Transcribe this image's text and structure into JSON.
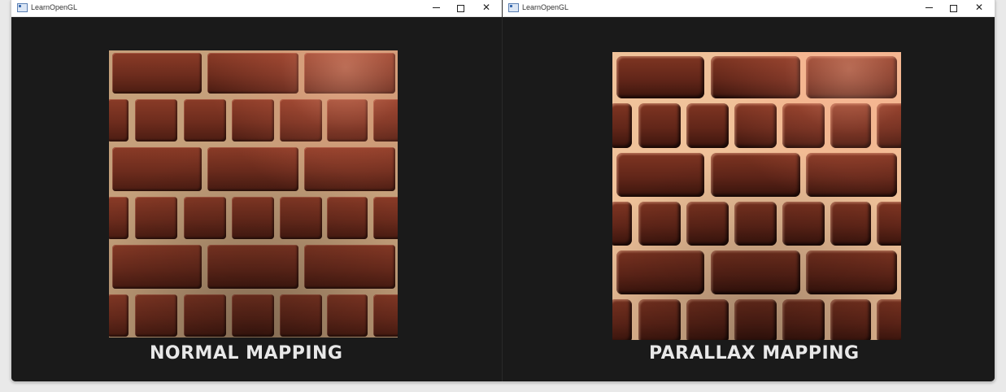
{
  "left_window": {
    "title": "LearnOpenGL",
    "caption": "NORMAL MAPPING",
    "controls": {
      "minimize_icon": "minimize-icon",
      "maximize_icon": "maximize-icon",
      "close_icon": "close-icon"
    }
  },
  "right_window": {
    "title": "LearnOpenGL",
    "caption": "PARALLAX MAPPING",
    "controls": {
      "minimize_icon": "minimize-icon",
      "maximize_icon": "maximize-icon",
      "close_icon": "close-icon"
    }
  },
  "colors": {
    "viewport_background": "#1a1a1a",
    "brick": "#6d2c1d",
    "mortar": "#d9b48e",
    "caption_text": "#e8e8e8",
    "titlebar": "#ffffff"
  },
  "close_glyph": "✕"
}
